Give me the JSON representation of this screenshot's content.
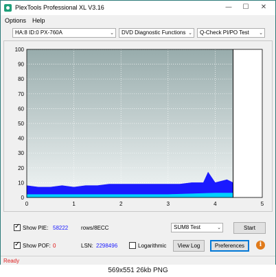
{
  "window": {
    "title": "PlexTools Professional XL V3.16",
    "minimize_glyph": "—",
    "maximize_glyph": "☐",
    "close_glyph": "✕"
  },
  "menu": {
    "options": "Options",
    "help": "Help"
  },
  "toolbar": {
    "drive": "HA:8 ID:0  PX-760A",
    "function": "DVD Diagnostic Functions",
    "test": "Q-Check PI/PO Test"
  },
  "chart_data": {
    "type": "area",
    "xlim": [
      0,
      5
    ],
    "ylim": [
      0,
      100
    ],
    "x_ticks": [
      "0",
      "1",
      "2",
      "3",
      "4",
      "5"
    ],
    "y_ticks": [
      "100",
      "90",
      "80",
      "70",
      "60",
      "50",
      "40",
      "30",
      "20",
      "10",
      "0"
    ],
    "end_marker_x": 4.38,
    "grid": true,
    "series": [
      {
        "color": "#1a1aff",
        "x": [
          0,
          0.25,
          0.5,
          0.75,
          1.0,
          1.25,
          1.5,
          1.75,
          2.0,
          2.25,
          2.5,
          2.75,
          3.0,
          3.25,
          3.5,
          3.75,
          3.85,
          4.0,
          4.25,
          4.38
        ],
        "values": [
          8,
          7,
          7,
          8,
          7,
          8,
          8,
          9,
          9,
          9,
          9,
          9,
          9,
          9,
          10,
          10,
          17,
          10,
          12,
          10
        ]
      },
      {
        "color": "#00d0ff",
        "x": [
          0,
          1,
          2,
          3,
          4,
          4.38
        ],
        "values": [
          2,
          2,
          2,
          2,
          3,
          3
        ]
      }
    ]
  },
  "controls": {
    "show_pie_label": "Show PIE:",
    "pie_value": "58222",
    "pie_unit": "rows/8ECC",
    "show_pof_label": "Show POF:",
    "pof_value": "0",
    "lsn_label": "LSN:",
    "lsn_value": "2298496",
    "logarithmic_label": "Logarithmic",
    "test_select": "SUM8 Test",
    "start_button": "Start",
    "view_log_button": "View Log",
    "preferences_button": "Preferences",
    "info_glyph": "i"
  },
  "status": {
    "text": "Ready"
  },
  "caption": "569x551  26kb  PNG",
  "colors": {
    "pie": "#1a1aff",
    "pof": "#e01010",
    "lsn": "#1a1aff",
    "status": "#e02020"
  }
}
